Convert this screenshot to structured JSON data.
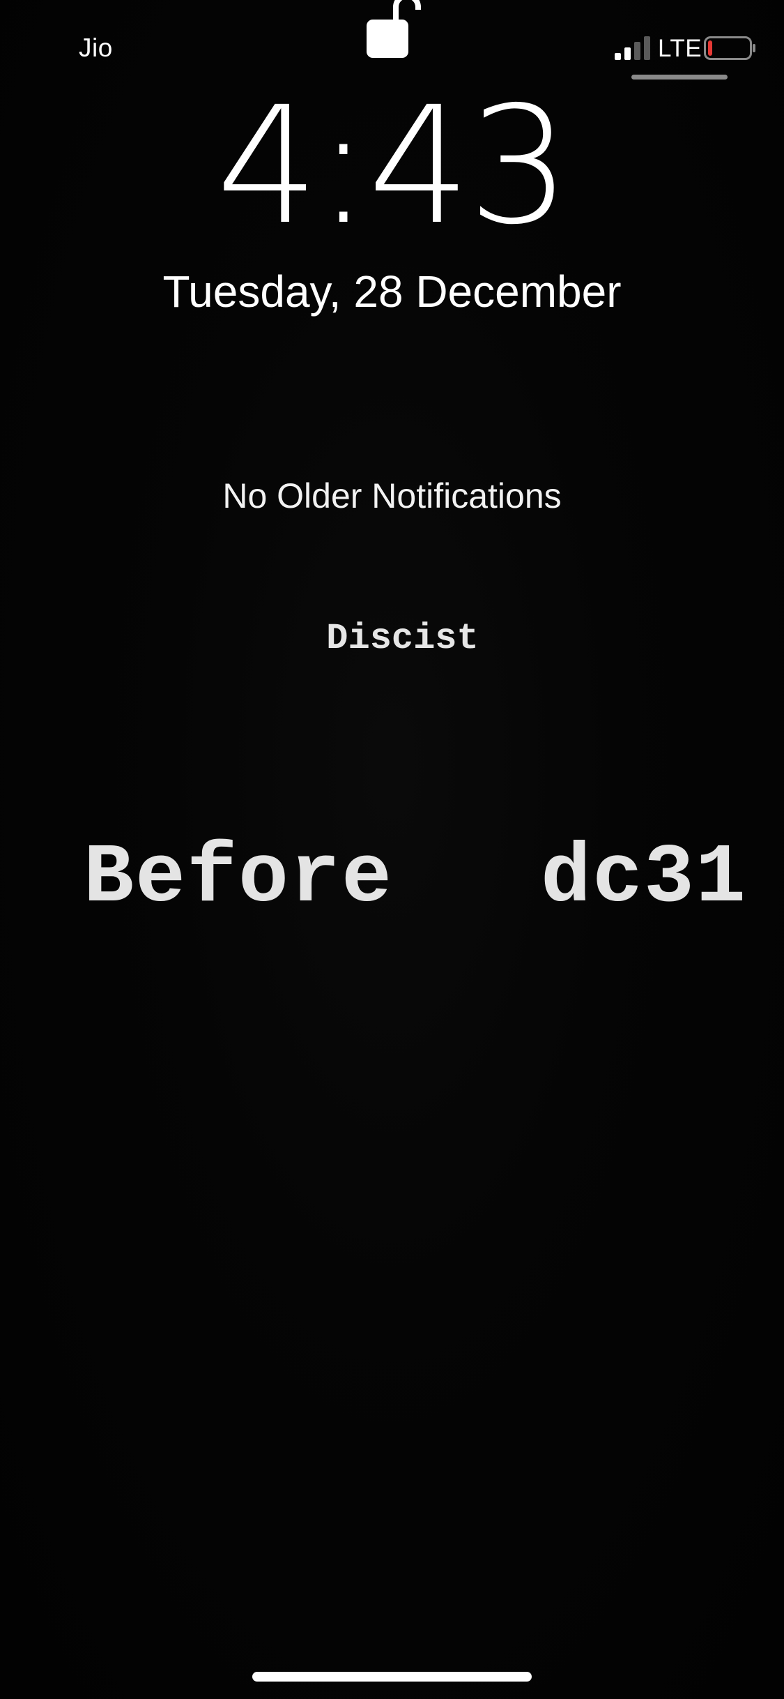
{
  "status_bar": {
    "carrier": "Jio",
    "network_type": "LTE",
    "signal_bars_active": 2,
    "signal_bars_total": 4,
    "battery_level": 0.1,
    "battery_color": "#e53935",
    "lock_icon": "unlocked-padlock-icon"
  },
  "lock_screen": {
    "time": "4:43",
    "date": "Tuesday, 28 December",
    "notifications_message": "No Older Notifications"
  },
  "wallpaper": {
    "line_small": "Discist",
    "line_big_left": "Before",
    "line_big_right": "dc31",
    "text_color": "#e4e4e4",
    "background_color": "#030303"
  }
}
